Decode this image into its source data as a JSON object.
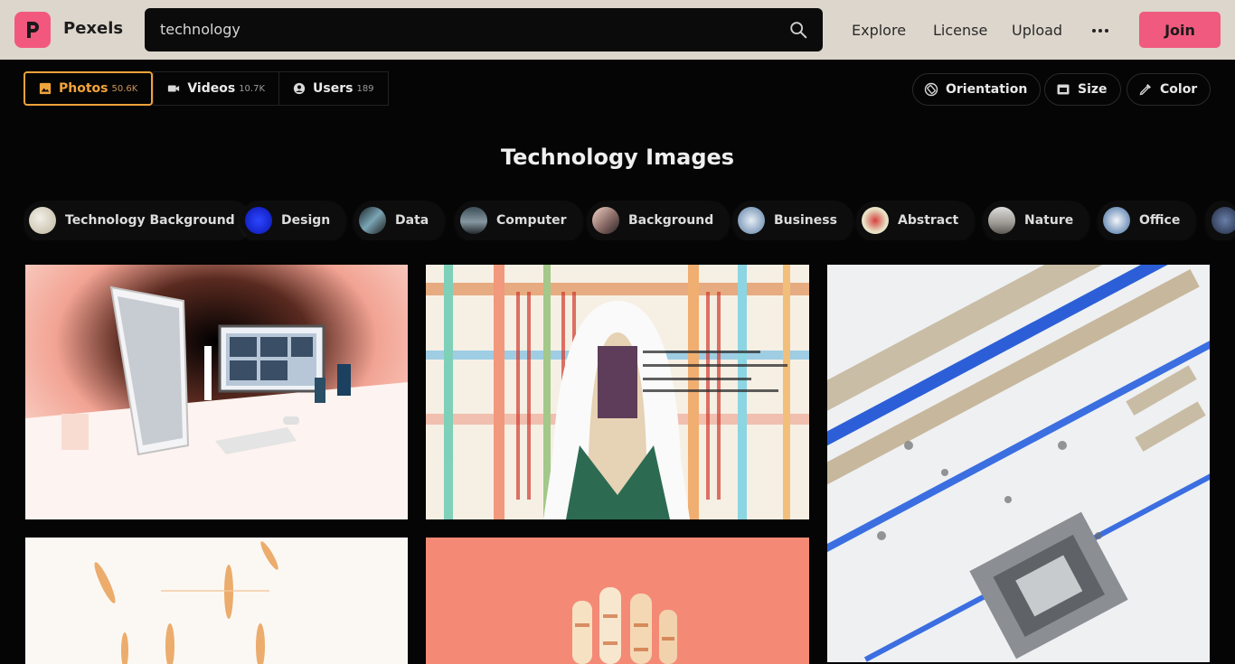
{
  "header": {
    "brand": "Pexels",
    "search_value": "technology",
    "nav": [
      "Explore",
      "License",
      "Upload"
    ],
    "join_label": "Join"
  },
  "tabs": [
    {
      "label": "Photos",
      "count": "50.6K",
      "icon": "image-icon",
      "active": true
    },
    {
      "label": "Videos",
      "count": "10.7K",
      "icon": "video-icon",
      "active": false
    },
    {
      "label": "Users",
      "count": "189",
      "icon": "user-icon",
      "active": false
    }
  ],
  "filters": {
    "orientation": "Orientation",
    "size": "Size",
    "color": "Color"
  },
  "page_title": "Technology Images",
  "categories": [
    "Technology Background",
    "Design",
    "Data",
    "Computer",
    "Background",
    "Business",
    "Abstract",
    "Nature",
    "Office"
  ],
  "colors": {
    "accent": "#f0a23a",
    "brand": "#f2587e",
    "header_bg": "#ddd6cc",
    "page_bg": "#050505"
  }
}
